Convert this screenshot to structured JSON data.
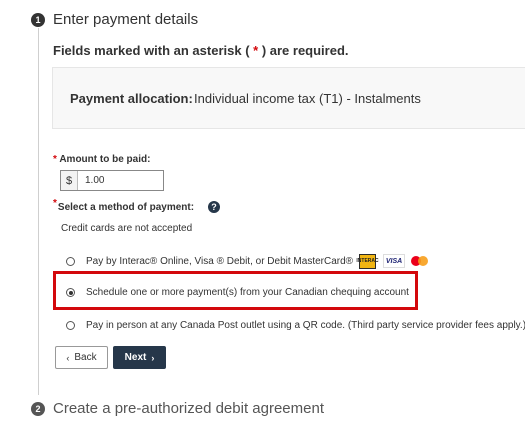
{
  "step1": {
    "number": "1",
    "title": "Enter payment details"
  },
  "required_note": {
    "before": "Fields marked with an asterisk ( ",
    "asterisk": "*",
    "after": " ) are required."
  },
  "allocation": {
    "label": "Payment allocation:",
    "value": "Individual income tax (T1) - Instalments"
  },
  "amount": {
    "asterisk": "*",
    "label": "Amount to be paid:",
    "currency": "$",
    "value": "1.00"
  },
  "method": {
    "asterisk": "*",
    "label": "Select a method of payment:",
    "help_icon": "question-circle-icon",
    "note": "Credit cards are not accepted"
  },
  "payment_options": [
    {
      "label": "Pay by Interac® Online, Visa ® Debit, or Debit MasterCard®",
      "checked": false,
      "logos": {
        "interac": "INTERAC",
        "visa": "VISA",
        "mastercard": "mastercard-logo"
      }
    },
    {
      "label": "Schedule one or more payment(s) from your Canadian chequing account",
      "checked": true
    },
    {
      "label": "Pay in person at any Canada Post outlet using a QR code. (Third party service provider fees apply.)",
      "checked": false
    }
  ],
  "buttons": {
    "back": "Back",
    "next": "Next"
  },
  "step2": {
    "number": "2",
    "title": "Create a pre-authorized debit agreement"
  },
  "colors": {
    "accent_red": "#d3080c",
    "primary_button": "#26374a"
  }
}
